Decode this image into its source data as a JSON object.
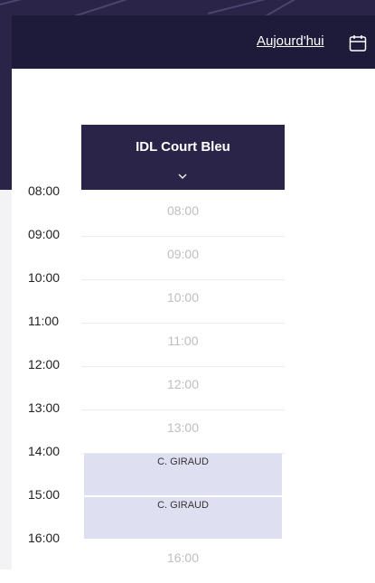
{
  "header": {
    "today_label": "Aujourd'hui",
    "calendar_icon": "calendar-icon"
  },
  "court": {
    "name": "IDL Court Bleu",
    "dropdown_icon": "chevron-down-icon"
  },
  "timeline": {
    "hours": [
      "08:00",
      "09:00",
      "10:00",
      "11:00",
      "12:00",
      "13:00",
      "14:00",
      "15:00",
      "16:00"
    ]
  },
  "slots": [
    {
      "label": "08:00"
    },
    {
      "label": "09:00"
    },
    {
      "label": "10:00"
    },
    {
      "label": "11:00"
    },
    {
      "label": "12:00"
    },
    {
      "label": "13:00"
    },
    {
      "label": "16:00"
    }
  ],
  "bookings": [
    {
      "name": "C. GIRAUD",
      "start": "14:00",
      "end": "15:00"
    },
    {
      "name": "C. GIRAUD",
      "start": "15:00",
      "end": "16:00"
    }
  ],
  "colors": {
    "header_bg": "#1e1b3a",
    "court_bg": "#2a2548",
    "booking_bg": "#dfdff2"
  }
}
